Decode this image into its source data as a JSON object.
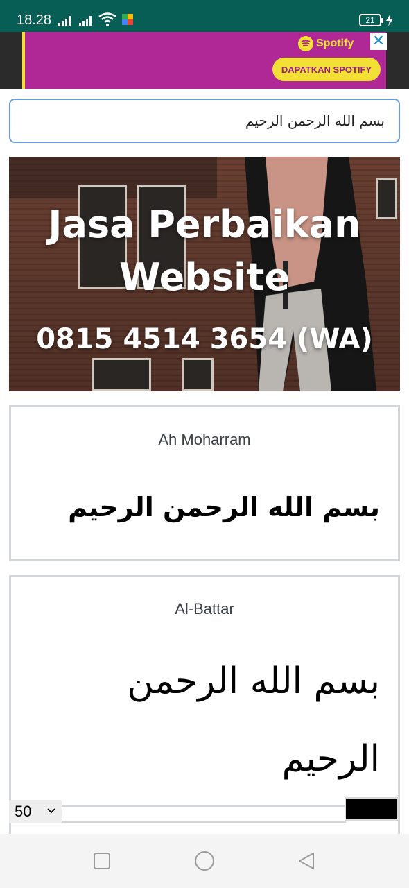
{
  "status_bar": {
    "time": "18.28",
    "battery": "21",
    "icons": [
      "signal-icon",
      "signal-icon",
      "wifi-icon",
      "app-notification-icon",
      "battery-icon",
      "charging-icon"
    ]
  },
  "ad": {
    "brand": "Spotify",
    "cta": "DAPATKAN SPOTIFY",
    "close_glyph": "✕",
    "colors": {
      "background": "#af2896",
      "accent": "#f3e034"
    }
  },
  "input": {
    "value": "بسم الله الرحمن الرحيم"
  },
  "promo": {
    "title_line1": "Jasa Perbaikan",
    "title_line2": "Website",
    "phone": "0815 4514 3654 (WA)"
  },
  "cards": [
    {
      "font_name": "Ah Moharram",
      "preview": "بسم الله الرحمن الرحيم"
    },
    {
      "font_name": "Al-Battar",
      "preview_line1": "بسم الله الرحمن",
      "preview_line2": "الرحيم"
    }
  ],
  "controls": {
    "font_size": "50",
    "color": "#000000"
  },
  "navbar": {
    "icons": [
      "recent-apps-icon",
      "home-icon",
      "back-icon"
    ]
  }
}
